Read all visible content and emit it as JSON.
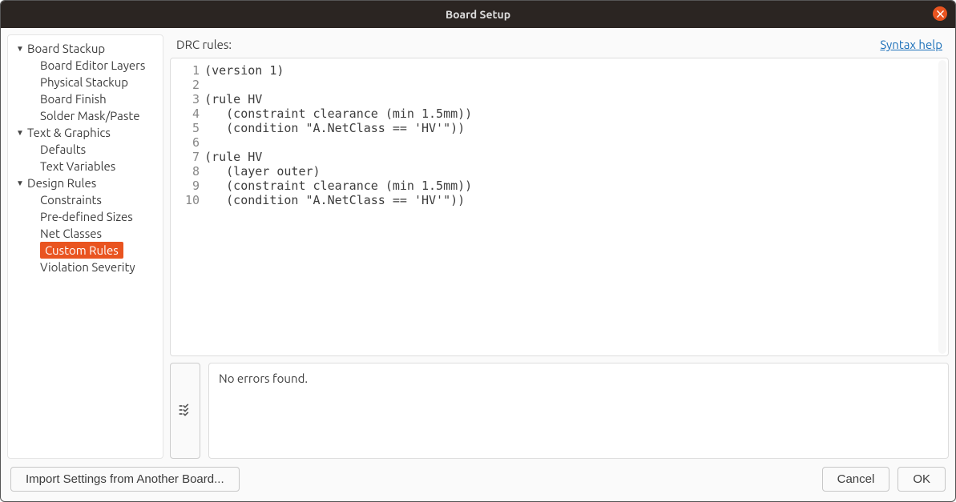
{
  "window": {
    "title": "Board Setup"
  },
  "sidebar": {
    "groups": [
      {
        "label": "Board Stackup",
        "items": [
          "Board Editor Layers",
          "Physical Stackup",
          "Board Finish",
          "Solder Mask/Paste"
        ]
      },
      {
        "label": "Text & Graphics",
        "items": [
          "Defaults",
          "Text Variables"
        ]
      },
      {
        "label": "Design Rules",
        "items": [
          "Constraints",
          "Pre-defined Sizes",
          "Net Classes",
          "Custom Rules",
          "Violation Severity"
        ]
      }
    ],
    "active": "Custom Rules"
  },
  "content": {
    "drc_label": "DRC rules:",
    "syntax_help": "Syntax help",
    "code_lines": [
      "(version 1)",
      "",
      "(rule HV",
      "   (constraint clearance (min 1.5mm))",
      "   (condition \"A.NetClass == 'HV'\"))",
      "",
      "(rule HV",
      "   (layer outer)",
      "   (constraint clearance (min 1.5mm))",
      "   (condition \"A.NetClass == 'HV'\"))"
    ],
    "status": "No errors found."
  },
  "footer": {
    "import": "Import Settings from Another Board...",
    "cancel": "Cancel",
    "ok": "OK"
  }
}
